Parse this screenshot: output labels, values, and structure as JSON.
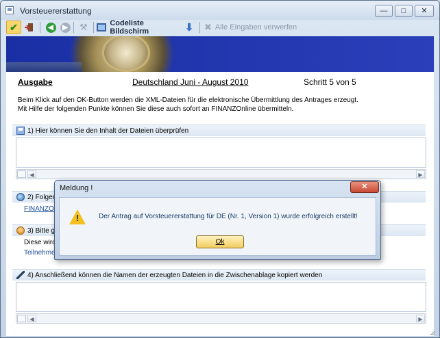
{
  "window": {
    "title": "Vorsteuererstattung"
  },
  "toolbar": {
    "codeliste_label": "Codeliste Bildschirm",
    "discard_label": "Alle Eingaben verwerfen"
  },
  "header": {
    "ausgabe": "Ausgabe",
    "period": "Deutschland Juni - August 2010",
    "step": "Schritt 5 von 5"
  },
  "intro": {
    "line1": "Beim Klick auf den OK-Button werden die XML-Dateien für die elektronische Übermittlung des Antrages erzeugt.",
    "line2": "Mit Hilfe der folgenden Punkte können Sie diese auch sofort an FINANZOnline übermitteln."
  },
  "sections": {
    "s1": "1) Hier können Sie den Inhalt der Dateien überprüfen",
    "s2": "2) Folgen",
    "s2_link": "FINANZOn",
    "s3": "3) Bitte ge",
    "s3_text": "Diese wird",
    "s3_link": "Teilnehmer",
    "s4": "4) Anschließend können die Namen der erzeugten Dateien in die Zwischenablage kopiert werden"
  },
  "dialog": {
    "title": "Meldung !",
    "message": "Der Antrag auf Vorsteuererstattung für DE (Nr. 1, Version 1) wurde erfolgreich erstellt!",
    "ok_label": "Ok"
  },
  "colors": {
    "banner": "#2236ae",
    "ok_button": "#f1cd60",
    "dialog_close": "#c84a33"
  }
}
